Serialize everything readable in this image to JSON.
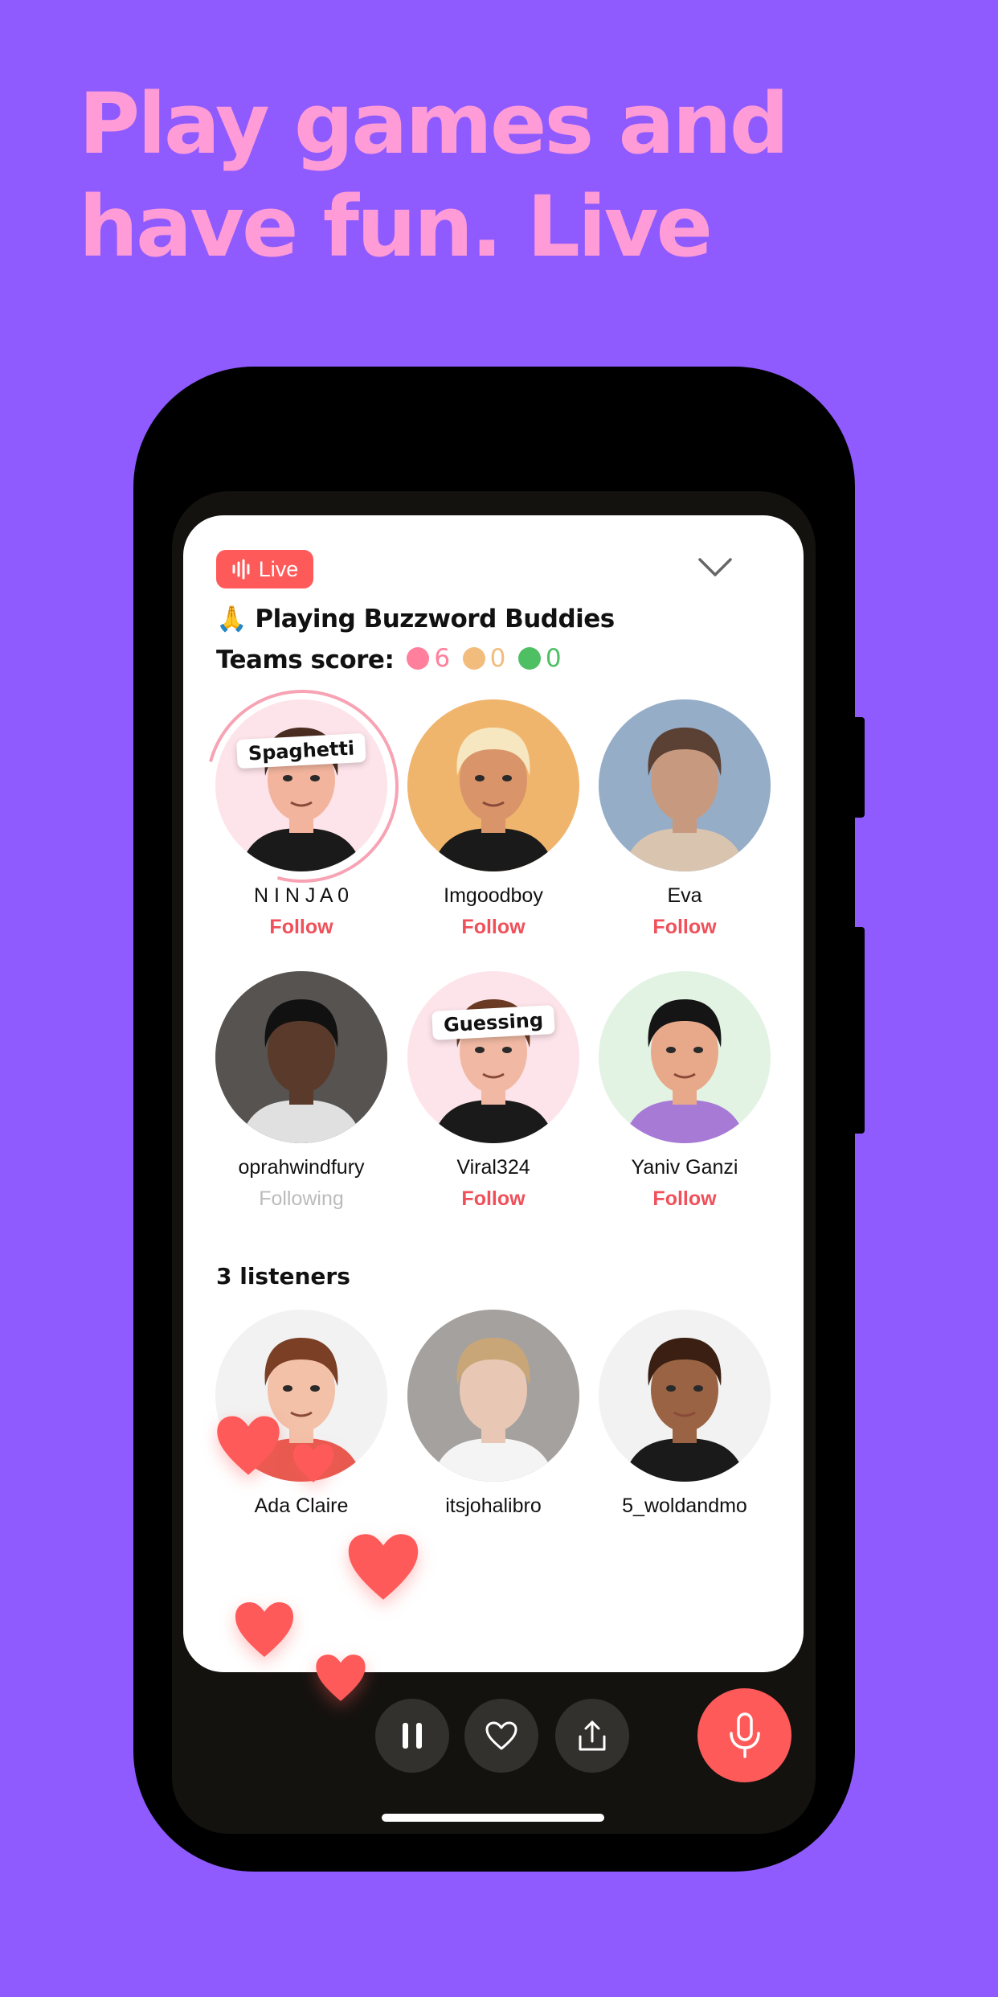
{
  "headline": {
    "line1": "Play games and",
    "line2": "have fun. Live"
  },
  "room": {
    "live_label": "Live",
    "title": "🙏 Playing Buzzword Buddies",
    "score_label": "Teams score:",
    "teams": [
      {
        "color": "#ff7f9c",
        "score": "6"
      },
      {
        "color": "#f2bc7c",
        "score": "0"
      },
      {
        "color": "#4fbf64",
        "score": "0"
      }
    ]
  },
  "speakers": [
    {
      "name": "N I N J A 0",
      "action": "Follow",
      "tag": "Spaghetti",
      "speaking": true,
      "avatar": {
        "bg": "#fde4ea",
        "skin": "#f3b49d",
        "hair": "#4a2c20",
        "shirt": "#1a1a1a"
      }
    },
    {
      "name": "Imgoodboy",
      "action": "Follow",
      "avatar": {
        "bg": "#f0b56d",
        "skin": "#d9946a",
        "hair": "#f6e7c0",
        "shirt": "#1a1a1a"
      }
    },
    {
      "name": "Eva",
      "action": "Follow",
      "avatar": {
        "photo": true,
        "bg": "#7fa6cf",
        "skin": "#c79a80",
        "hair": "#5b4034",
        "shirt": "#d9c4b0"
      }
    },
    {
      "name": "oprahwindfury",
      "action": "Following",
      "following": true,
      "avatar": {
        "photo": true,
        "bg": "#2a2522",
        "skin": "#5a3a2a",
        "hair": "#111",
        "shirt": "#e0e0e0"
      }
    },
    {
      "name": "Viral324",
      "action": "Follow",
      "tag": "Guessing",
      "avatar": {
        "bg": "#fde4ea",
        "skin": "#f1b9a3",
        "hair": "#6b3a24",
        "shirt": "#1a1a1a"
      }
    },
    {
      "name": "Yaniv Ganzi",
      "action": "Follow",
      "avatar": {
        "bg": "#e2f3e4",
        "skin": "#e8a98a",
        "hair": "#151515",
        "shirt": "#a77ad6"
      }
    }
  ],
  "listeners_label": "3 listeners",
  "listeners": [
    {
      "name": "Ada Claire",
      "avatar": {
        "bg": "#f2f2f2",
        "skin": "#f3c0a8",
        "hair": "#7a3f24",
        "shirt": "#e85a4f"
      }
    },
    {
      "name": "itsjohalibro",
      "avatar": {
        "photo": true,
        "bg": "#8a8683",
        "skin": "#e8c8b4",
        "hair": "#c9a678",
        "shirt": "#f4f4f4"
      }
    },
    {
      "name": "5_woldandmo",
      "avatar": {
        "bg": "#f2f2f2",
        "skin": "#9a6444",
        "hair": "#3a1f12",
        "shirt": "#1a1a1a"
      }
    }
  ],
  "controls": {
    "pause_icon": "pause-icon",
    "like_icon": "heart-icon",
    "share_icon": "share-icon",
    "mic_icon": "microphone-icon"
  },
  "colors": {
    "background": "#8f5bff",
    "headline": "#ff9bd6",
    "accent": "#ff5a5a"
  }
}
